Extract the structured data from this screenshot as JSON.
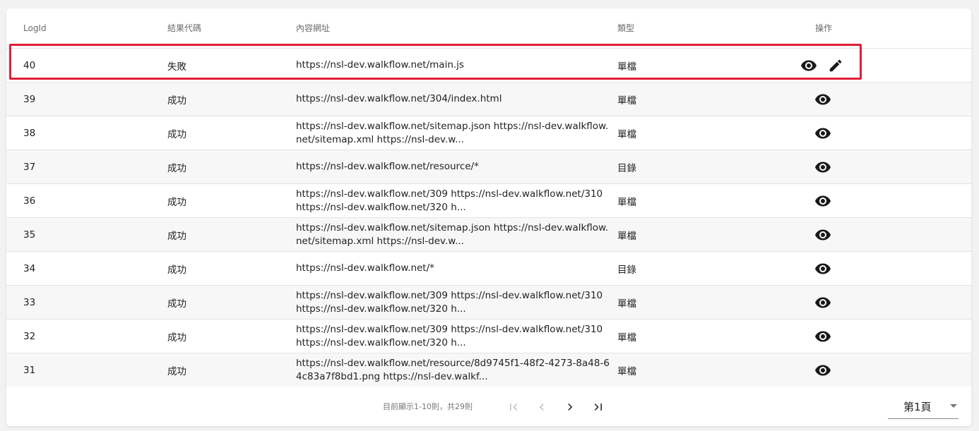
{
  "table": {
    "headers": {
      "log_id": "LogId",
      "result_code": "結果代碼",
      "content_url": "內容網址",
      "type": "類型",
      "actions": "操作"
    },
    "rows": [
      {
        "id": "40",
        "result": "失敗",
        "url": "https://nsl-dev.walkflow.net/main.js",
        "type": "單檔",
        "editable": true
      },
      {
        "id": "39",
        "result": "成功",
        "url": "https://nsl-dev.walkflow.net/304/index.html",
        "type": "單檔",
        "editable": false
      },
      {
        "id": "38",
        "result": "成功",
        "url": "https://nsl-dev.walkflow.net/sitemap.json https://nsl-dev.walkflow.net/sitemap.xml https://nsl-dev.w...",
        "type": "單檔",
        "editable": false
      },
      {
        "id": "37",
        "result": "成功",
        "url": "https://nsl-dev.walkflow.net/resource/*",
        "type": "目錄",
        "editable": false
      },
      {
        "id": "36",
        "result": "成功",
        "url": "https://nsl-dev.walkflow.net/309 https://nsl-dev.walkflow.net/310 https://nsl-dev.walkflow.net/320 h...",
        "type": "單檔",
        "editable": false
      },
      {
        "id": "35",
        "result": "成功",
        "url": "https://nsl-dev.walkflow.net/sitemap.json https://nsl-dev.walkflow.net/sitemap.xml https://nsl-dev.w...",
        "type": "單檔",
        "editable": false
      },
      {
        "id": "34",
        "result": "成功",
        "url": "https://nsl-dev.walkflow.net/*",
        "type": "目錄",
        "editable": false
      },
      {
        "id": "33",
        "result": "成功",
        "url": "https://nsl-dev.walkflow.net/309 https://nsl-dev.walkflow.net/310 https://nsl-dev.walkflow.net/320 h...",
        "type": "單檔",
        "editable": false
      },
      {
        "id": "32",
        "result": "成功",
        "url": "https://nsl-dev.walkflow.net/309 https://nsl-dev.walkflow.net/310 https://nsl-dev.walkflow.net/320 h...",
        "type": "單檔",
        "editable": false
      },
      {
        "id": "31",
        "result": "成功",
        "url": "https://nsl-dev.walkflow.net/resource/8d9745f1-48f2-4273-8a48-64c83a7f8bd1.png https://nsl-dev.walkf...",
        "type": "單檔",
        "editable": false
      }
    ]
  },
  "pagination": {
    "summary": "目前顯示1-10則，共29則",
    "page_label": "第1頁",
    "buttons": [
      "first-page-icon",
      "prev-page-icon",
      "next-page-icon",
      "last-page-icon"
    ]
  },
  "colors": {
    "highlight": "#e11d38",
    "icon": "#1a1a1a",
    "icon_disabled": "#c4c4c4"
  }
}
